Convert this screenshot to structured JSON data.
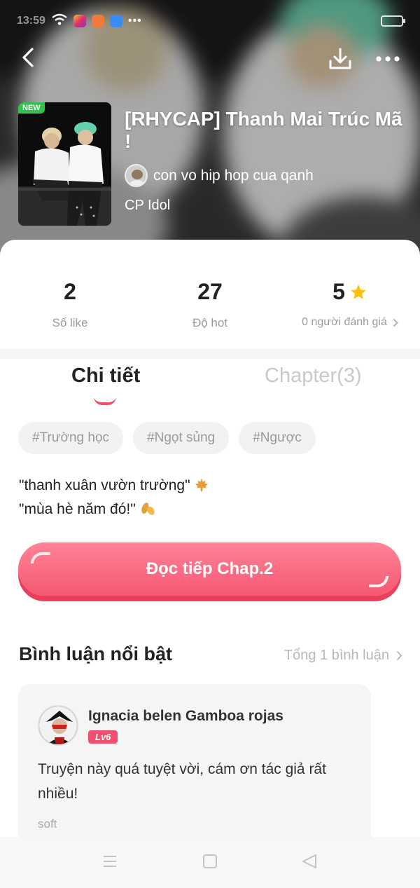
{
  "status_bar": {
    "time": "13:59"
  },
  "header": {
    "badge": "NEW",
    "title": "[RHYCAP] Thanh Mai Trúc Mã !",
    "author": "con vo hip hop cua qanh",
    "genre": "CP Idol"
  },
  "stats": {
    "likes": {
      "value": "2",
      "label": "Số like"
    },
    "hot": {
      "value": "27",
      "label": "Độ hot"
    },
    "rating": {
      "value": "5",
      "label": "0 người đánh giá"
    }
  },
  "tabs": [
    {
      "label": "Chi tiết",
      "active": true
    },
    {
      "label": "Chapter(3)",
      "active": false
    }
  ],
  "tags": [
    "#Trường học",
    "#Ngọt sủng",
    "#Ngược"
  ],
  "description": {
    "line1": "\"thanh xuân vườn trường\"",
    "line2": "\"mùa hè năm đó!\""
  },
  "read_button": {
    "label": "Đọc tiếp Chap.2"
  },
  "comments": {
    "title": "Bình luận nổi bật",
    "total": "Tổng 1 bình luận",
    "items": [
      {
        "user": "Ignacia belen Gamboa rojas",
        "level": "Lv6",
        "text": "Truyện này quá tuyệt vời, cám ơn tác giả rất nhiều!",
        "meta": "soft"
      }
    ]
  },
  "colors": {
    "accent": "#f0506e",
    "star": "#ffc107",
    "badge_new": "#33c04f"
  },
  "icons": [
    "back-arrow-icon",
    "download-icon",
    "more-dots-icon",
    "star-icon",
    "chevron-right-icon",
    "maple-leaf-icon",
    "leaves-icon",
    "menu-lines-icon",
    "home-square-icon",
    "back-triangle-icon"
  ]
}
